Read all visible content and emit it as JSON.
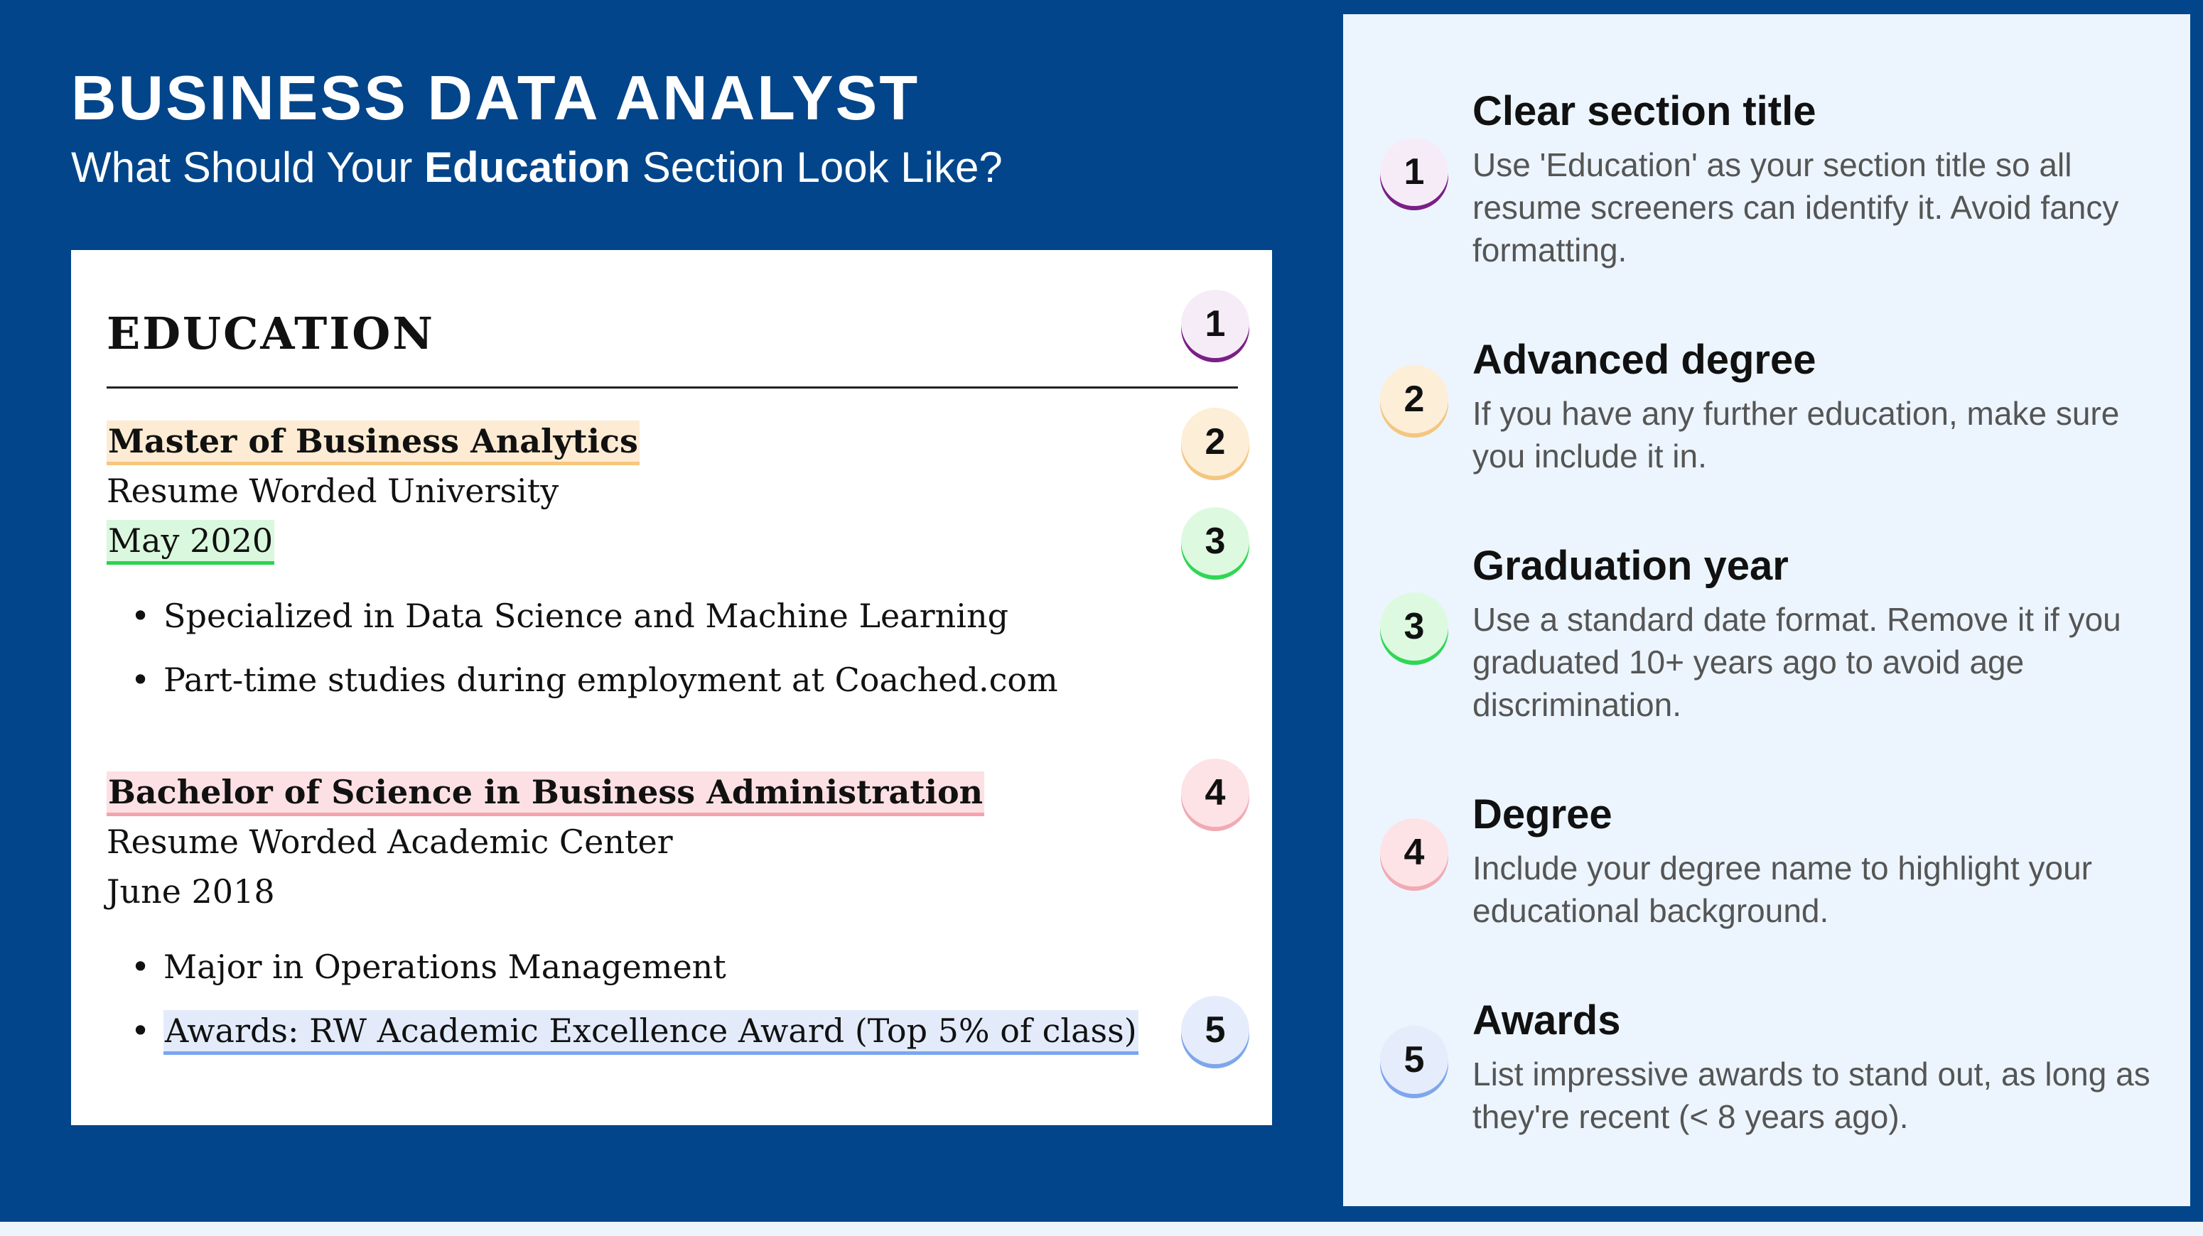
{
  "header": {
    "title": "BUSINESS DATA ANALYST",
    "subtitle_before": "What Should Your ",
    "subtitle_bold": "Education",
    "subtitle_after": " Section Look Like?"
  },
  "resume": {
    "section_heading": "EDUCATION",
    "entries": [
      {
        "degree": "Master of Business Analytics",
        "school": "Resume Worded University",
        "date": "May 2020",
        "bullets": [
          "Specialized in Data Science and Machine Learning",
          "Part-time studies during employment at Coached.com"
        ]
      },
      {
        "degree": "Bachelor of Science in Business Administration",
        "school": "Resume Worded Academic Center",
        "date": "June 2018",
        "bullets": [
          "Major in Operations Management",
          "Awards: RW Academic Excellence Award (Top 5% of class)"
        ]
      }
    ],
    "bullet_glyph": "•"
  },
  "markers": [
    "1",
    "2",
    "3",
    "4",
    "5"
  ],
  "tips": [
    {
      "number": "1",
      "title": "Clear section title",
      "description": "Use 'Education' as your section title so all resume screeners can identify it. Avoid fancy formatting."
    },
    {
      "number": "2",
      "title": "Advanced degree",
      "description": "If you have any further education, make sure you include it in."
    },
    {
      "number": "3",
      "title": "Graduation year",
      "description": "Use a standard date format. Remove it if you graduated 10+ years ago to avoid age discrimination."
    },
    {
      "number": "4",
      "title": "Degree",
      "description": "Include your degree name to highlight your educational background."
    },
    {
      "number": "5",
      "title": "Awards",
      "description": "List impressive awards to stand out, as long as they're recent (< 8 years ago)."
    }
  ],
  "colors": {
    "navy_background": "#02458a",
    "tips_background": "#ecf5fe",
    "marker_1": "#7b1f86",
    "marker_2": "#f3c681",
    "marker_3": "#31d655",
    "marker_4": "#f1aab3",
    "marker_5": "#7ea6eb"
  }
}
